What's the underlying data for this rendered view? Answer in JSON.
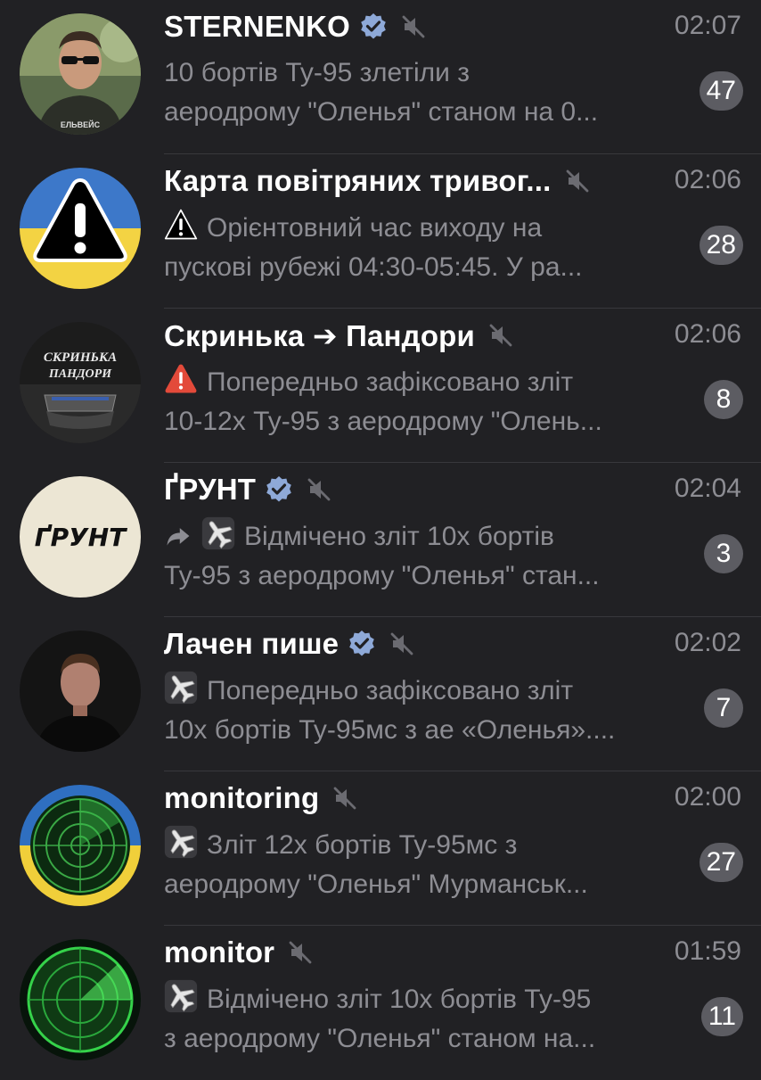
{
  "chats": [
    {
      "name": "STERNENKO",
      "verified": true,
      "muted": true,
      "time": "02:07",
      "preview_line1": "10 бортів Ту-95 злетіли з",
      "preview_line2": "аеродрому \"Оленья\" станом на 0...",
      "unread": "47",
      "avatar_shirt_text": "ЕЛЬВЕЙС",
      "preview_prefix_icons": []
    },
    {
      "name": "Карта повітряних тривог...",
      "verified": false,
      "muted": true,
      "time": "02:06",
      "preview_line1": "Орієнтовний час виходу на",
      "preview_line2": "пускові рубежі 04:30-05:45.  У ра...",
      "unread": "28",
      "preview_prefix_icons": [
        "warning-sign-icon"
      ]
    },
    {
      "name": "Скринька ➔ Пандори",
      "verified": false,
      "muted": true,
      "time": "02:06",
      "preview_line1": "Попередньо зафіксовано зліт",
      "preview_line2": "10-12х Ту-95 з аеродрому \"Олень...",
      "unread": "8",
      "avatar_text_line1": "СКРИНЬКА",
      "avatar_text_line2": "ПАНДОРИ",
      "preview_prefix_icons": [
        "red-warning-icon"
      ]
    },
    {
      "name": "ҐРУНТ",
      "verified": true,
      "muted": true,
      "time": "02:04",
      "preview_line1": "Відмічено зліт 10х бортів",
      "preview_line2": "Ту-95 з аеродрому \"Оленья\" стан...",
      "unread": "3",
      "avatar_text": "ҐРУНТ",
      "preview_prefix_icons": [
        "forward-arrow-icon",
        "airplane-icon"
      ]
    },
    {
      "name": "Лачен пише",
      "verified": true,
      "muted": true,
      "time": "02:02",
      "preview_line1": "Попередньо зафіксовано зліт",
      "preview_line2": "10х бортів Ту-95мс з ае «Оленья»....",
      "unread": "7",
      "preview_prefix_icons": [
        "airplane-icon"
      ]
    },
    {
      "name": "monitoring",
      "verified": false,
      "muted": true,
      "time": "02:00",
      "preview_line1": "Зліт 12х бортів Ту-95мс з",
      "preview_line2": "аеродрому \"Оленья\" Мурманськ...",
      "unread": "27",
      "preview_prefix_icons": [
        "airplane-icon"
      ]
    },
    {
      "name": "monitor",
      "verified": false,
      "muted": true,
      "time": "01:59",
      "preview_line1": "Відмічено зліт 10х бортів Ту-95",
      "preview_line2": "з аеродрому \"Оленья\" станом на...",
      "unread": "11",
      "preview_prefix_icons": [
        "airplane-icon"
      ]
    }
  ],
  "colors": {
    "background": "#212124",
    "title": "#ffffff",
    "secondary_text": "#8d8d93",
    "badge_muted": "#5c5c62",
    "verified": "#8ea9d8",
    "separator": "#38383c"
  }
}
